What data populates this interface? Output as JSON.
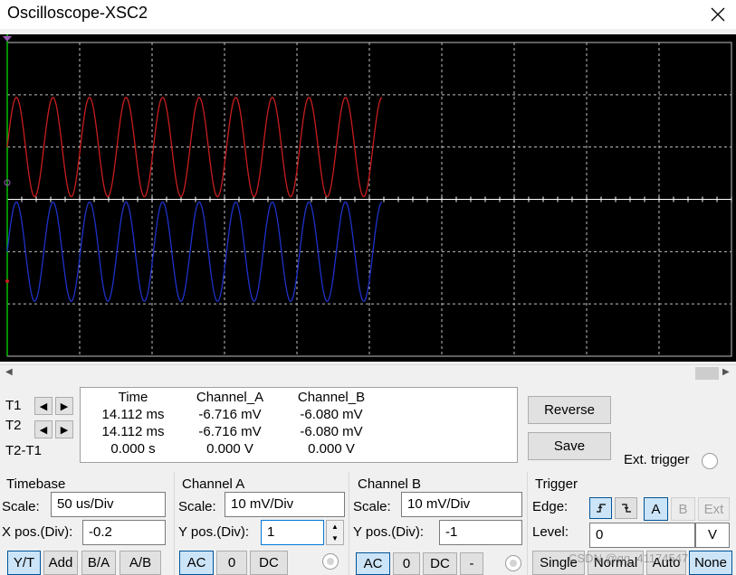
{
  "window": {
    "title": "Oscilloscope-XSC2"
  },
  "readout": {
    "row_labels": [
      "T1",
      "T2",
      "T2-T1"
    ],
    "headers": {
      "time": "Time",
      "channel_a": "Channel_A",
      "channel_b": "Channel_B"
    },
    "rows": [
      {
        "time": "14.112 ms",
        "a": "-6.716 mV",
        "b": "-6.080 mV"
      },
      {
        "time": "14.112 ms",
        "a": "-6.716 mV",
        "b": "-6.080 mV"
      },
      {
        "time": "0.000 s",
        "a": "0.000 V",
        "b": "0.000 V"
      }
    ]
  },
  "buttons": {
    "reverse": "Reverse",
    "save": "Save"
  },
  "ext_trigger": {
    "label": "Ext. trigger"
  },
  "timebase": {
    "title": "Timebase",
    "scale_label": "Scale:",
    "scale_value": "50 us/Div",
    "xpos_label": "X pos.(Div):",
    "xpos_value": "-0.2",
    "modes": [
      "Y/T",
      "Add",
      "B/A",
      "A/B"
    ],
    "selected_mode": "Y/T"
  },
  "channel_a": {
    "title": "Channel A",
    "scale_label": "Scale:",
    "scale_value": "10 mV/Div",
    "ypos_label": "Y pos.(Div):",
    "ypos_value": "1",
    "coupling": [
      "AC",
      "0",
      "DC"
    ],
    "selected_coupling": "AC"
  },
  "channel_b": {
    "title": "Channel B",
    "scale_label": "Scale:",
    "scale_value": "10 mV/Div",
    "ypos_label": "Y pos.(Div):",
    "ypos_value": "-1",
    "coupling": [
      "AC",
      "0",
      "DC",
      "-"
    ],
    "selected_coupling": "AC"
  },
  "trigger": {
    "title": "Trigger",
    "edge_label": "Edge:",
    "edge_sources": [
      "A",
      "B",
      "Ext"
    ],
    "selected_source": "A",
    "level_label": "Level:",
    "level_value": "0",
    "level_unit": "V",
    "modes": [
      "Single",
      "Normal",
      "Auto",
      "None"
    ],
    "selected_mode": "None"
  },
  "watermark": "CSDN @qq_41174547",
  "colors": {
    "channel_a": "#c81e1e",
    "channel_b": "#1e32c8",
    "grid": "#bfbfbf",
    "cursor": "#00c000"
  },
  "waveforms": {
    "cycles_shown": 10.25,
    "cycles_per_channel_window": 10,
    "channel_a_offset_div": 1,
    "channel_b_offset_div": -1
  }
}
